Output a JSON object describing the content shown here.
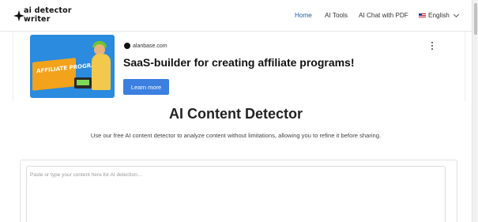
{
  "header": {
    "logo_line1": "ai detector",
    "logo_line2": "writer",
    "nav": {
      "home": "Home",
      "ai_tools": "AI Tools",
      "ai_chat_pdf": "AI Chat with PDF",
      "language": "English"
    },
    "active_color": "#1e5fa8"
  },
  "ad": {
    "image_text": "AFFILIATE PROGRAM",
    "source": "alanbase.com",
    "title": "SaaS-builder for creating affiliate programs!",
    "cta": "Learn more",
    "cta_color": "#3b7fe0"
  },
  "main": {
    "title": "AI Content Detector",
    "description": "Use our free AI content detector to analyze content without limitations, allowing you to refine it before sharing.",
    "editor_placeholder": "Paste or type your content here for AI detection..."
  },
  "icons": {
    "logo": "logo-icon",
    "flag": "us-flag-icon",
    "chevron": "chevron-down-icon",
    "menu": "kebab-menu-icon",
    "source": "alanbase-icon"
  }
}
